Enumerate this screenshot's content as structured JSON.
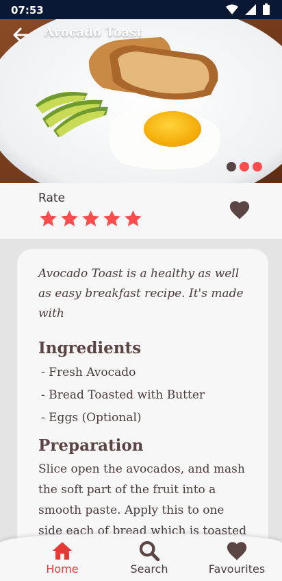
{
  "status_bar": {
    "time": "07:53",
    "icons": [
      "wifi-icon",
      "signal-icon",
      "battery-icon"
    ]
  },
  "header": {
    "title": "Avocado Toast",
    "back_icon": "arrow-left-icon"
  },
  "carousel": {
    "dot_count": 3,
    "active_color": "#ff4d4d",
    "inactive_color": "#5a4444"
  },
  "rating": {
    "label": "Rate",
    "stars": 5,
    "max_stars": 5,
    "favourite_icon": "heart-icon"
  },
  "recipe": {
    "intro": "Avocado Toast is a healthy as well as easy breakfast recipe. It's made with",
    "ingredients_title": "Ingredients",
    "ingredients": [
      " - Fresh Avocado",
      " - Bread Toasted with Butter",
      " - Eggs (Optional)"
    ],
    "preparation_title": "Preparation",
    "preparation": "Slice open the avocados, and mash the soft part of the fruit into a smooth paste. Apply this to one side each of bread which is toasted with"
  },
  "bottom_nav": {
    "items": [
      {
        "label": "Home",
        "icon": "home-icon",
        "active": true
      },
      {
        "label": "Search",
        "icon": "search-icon",
        "active": false
      },
      {
        "label": "Favourites",
        "icon": "heart-icon",
        "active": false
      }
    ]
  },
  "colors": {
    "accent": "#e53935",
    "star": "#ff4d4d",
    "brown": "#5a4444",
    "status_bar": "#0b1834"
  }
}
